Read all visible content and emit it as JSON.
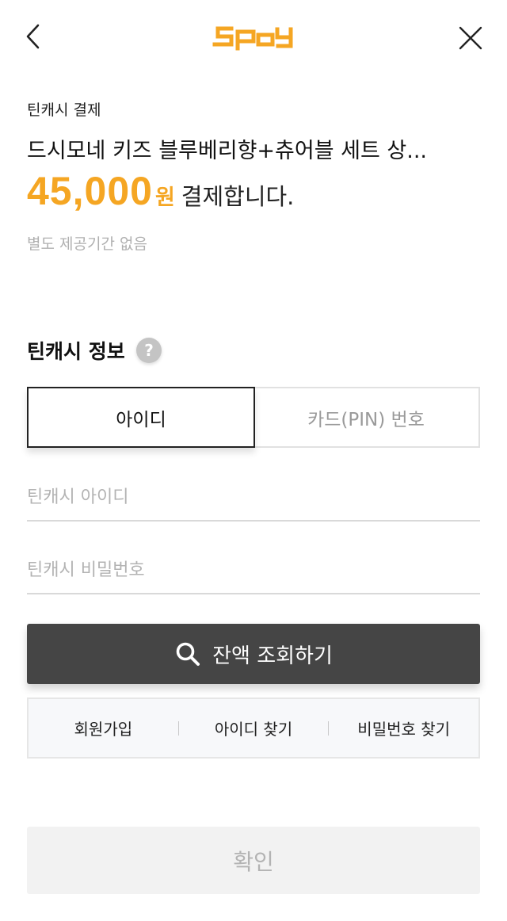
{
  "header": {
    "logo_text": "SPay",
    "brand_color": "#f5a623",
    "back_icon": "chevron-left-icon",
    "close_icon": "close-icon"
  },
  "payment": {
    "kind": "틴캐시 결제",
    "product_name": "드시모네 키즈 블루베리향+츄어블 세트 상...",
    "amount": "45,000",
    "currency_unit": "원",
    "amount_suffix": "결제합니다.",
    "period_note": "별도 제공기간 없음"
  },
  "teencash_info": {
    "title": "틴캐시 정보",
    "help_icon": "?",
    "tabs": [
      {
        "label": "아이디",
        "selected": true
      },
      {
        "label": "카드(PIN) 번호",
        "selected": false
      }
    ],
    "id_placeholder": "틴캐시 아이디",
    "pw_placeholder": "틴캐시 비밀번호"
  },
  "query_button": {
    "label": "잔액 조회하기",
    "icon": "search-icon"
  },
  "links": {
    "signup": "회원가입",
    "find_id": "아이디 찾기",
    "find_pw": "비밀번호 찾기"
  },
  "confirm_button": {
    "label": "확인"
  }
}
